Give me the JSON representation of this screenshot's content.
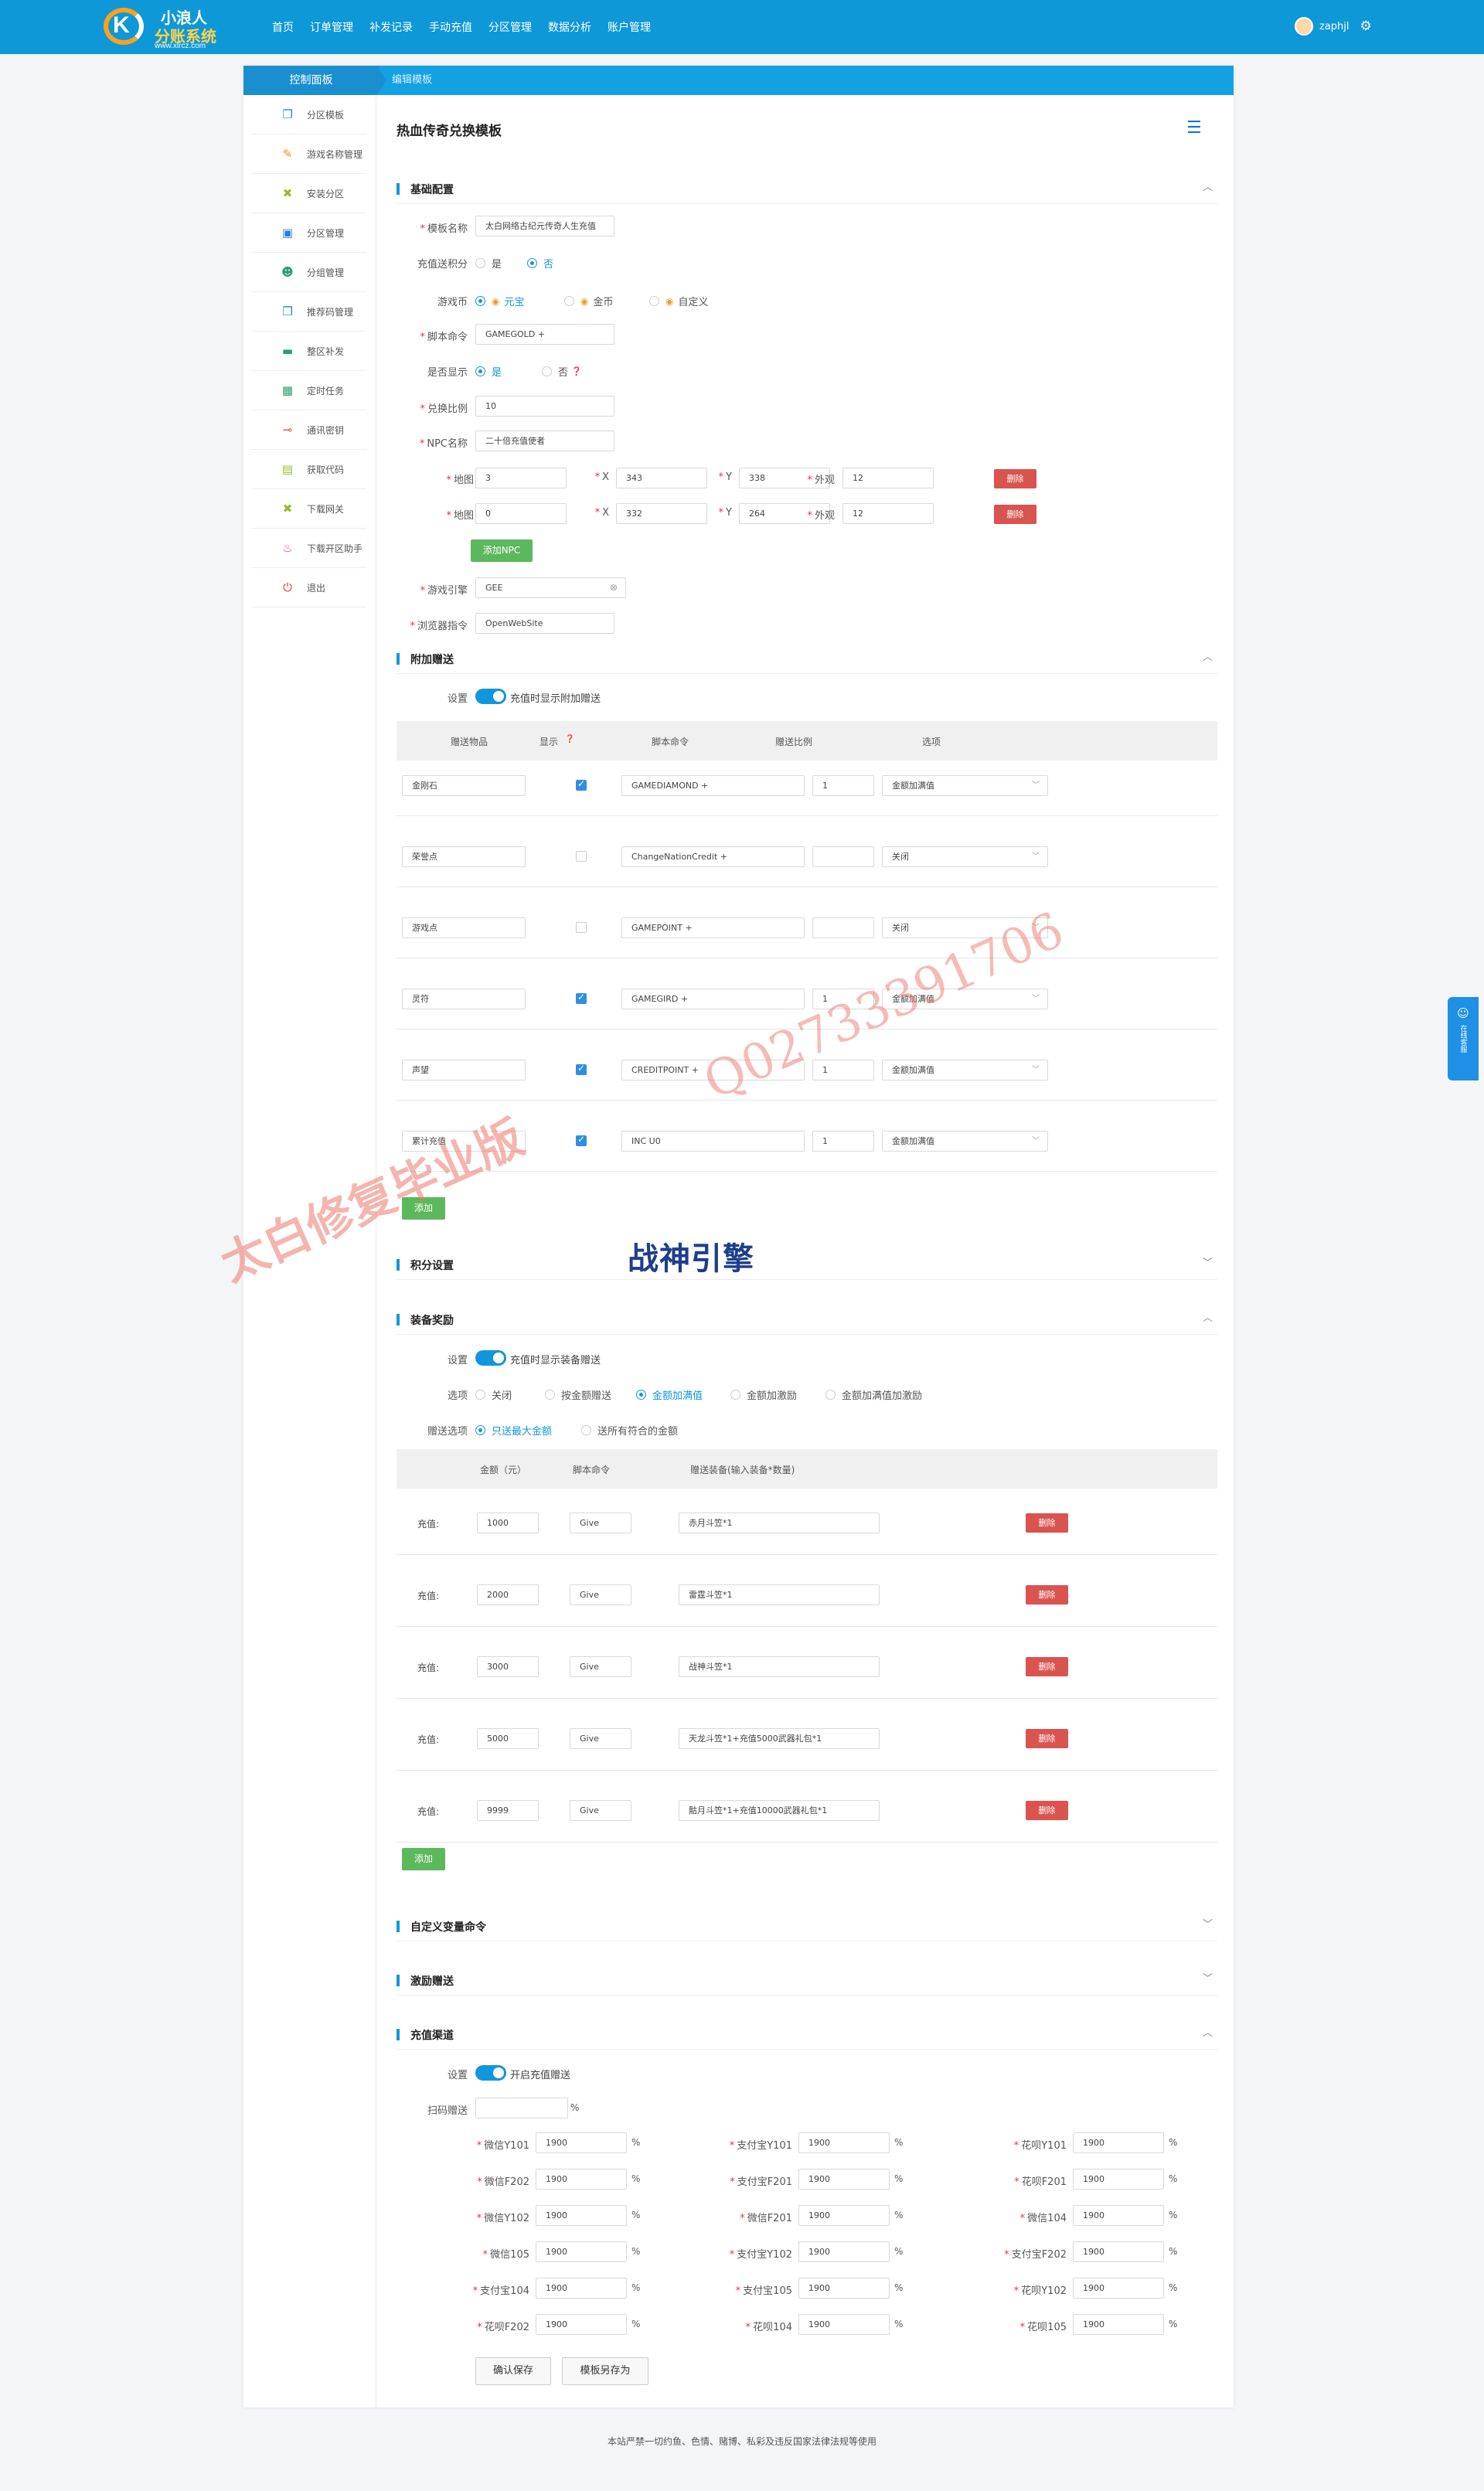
{
  "brand": {
    "line1": "小浪人",
    "line2": "分账系统",
    "url": "www.xlrcz.com"
  },
  "nav": [
    "首页",
    "订单管理",
    "补发记录",
    "手动充值",
    "分区管理",
    "数据分析",
    "账户管理"
  ],
  "user": {
    "name": "zaphjl"
  },
  "tabs": {
    "left": "控制面板",
    "right": "编辑模板"
  },
  "sidebar": [
    {
      "label": "分区模板",
      "icon": "copy-icon",
      "color": "#2a7ed6"
    },
    {
      "label": "游戏名称管理",
      "icon": "pen-icon",
      "color": "#f08b1a"
    },
    {
      "label": "安装分区",
      "icon": "wrench-icon",
      "color": "#8fbf29"
    },
    {
      "label": "分区管理",
      "icon": "monitor-icon",
      "color": "#2a7ed6"
    },
    {
      "label": "分组管理",
      "icon": "users-icon",
      "color": "#2a9d6c"
    },
    {
      "label": "推荐码管理",
      "icon": "copy-icon",
      "color": "#2a7ed6"
    },
    {
      "label": "整区补发",
      "icon": "folder-icon",
      "color": "#2a9d6c"
    },
    {
      "label": "定时任务",
      "icon": "grid-icon",
      "color": "#2a9d6c"
    },
    {
      "label": "通讯密钥",
      "icon": "key-icon",
      "color": "#e2542f"
    },
    {
      "label": "获取代码",
      "icon": "box-icon",
      "color": "#8fbf29"
    },
    {
      "label": "下载网关",
      "icon": "wrench-icon",
      "color": "#8fbf29"
    },
    {
      "label": "下载开区助手",
      "icon": "cake-icon",
      "color": "#d9368b"
    },
    {
      "label": "退出",
      "icon": "power-icon",
      "color": "#e33"
    }
  ],
  "page_title": "热血传奇兑换模板",
  "basic": {
    "title": "基础配置",
    "template_name": {
      "label": "模板名称",
      "value": "太白网络古纪元传奇人生充值"
    },
    "recharge_points": {
      "label": "充值送积分",
      "opt_yes": "是",
      "opt_no": "否",
      "selected": "否"
    },
    "currency": {
      "label": "游戏币",
      "opts": [
        "元宝",
        "金币",
        "自定义"
      ],
      "selected": "元宝"
    },
    "script_cmd": {
      "label": "脚本命令",
      "value": "GAMEGOLD +"
    },
    "show": {
      "label": "是否显示",
      "opt_yes": "是",
      "opt_no": "否",
      "selected": "是"
    },
    "ratio": {
      "label": "兑换比例",
      "value": "10"
    },
    "npc": {
      "label": "NPC名称",
      "value": "二十倍充值使者"
    },
    "maps": [
      {
        "map": "3",
        "x": "343",
        "y": "338",
        "look": "12"
      },
      {
        "map": "0",
        "x": "332",
        "y": "264",
        "look": "12"
      }
    ],
    "map_labels": {
      "map": "地图",
      "x": "X",
      "y": "Y",
      "look": "外观",
      "delete": "删除",
      "add_npc": "添加NPC"
    },
    "engine": {
      "label": "游戏引擎",
      "value": "GEE"
    },
    "browser": {
      "label": "浏览器指令",
      "value": "OpenWebSite"
    }
  },
  "bonus": {
    "title": "附加赠送",
    "setting_label": "设置",
    "setting_text": "充值时显示附加赠送",
    "headers": [
      "赠送物品",
      "显示",
      "脚本命令",
      "赠送比例",
      "选项"
    ],
    "rows": [
      {
        "item": "金刚石",
        "show": true,
        "cmd": "GAMEDIAMOND +",
        "ratio": "1",
        "option": "金额加满值"
      },
      {
        "item": "荣誉点",
        "show": false,
        "cmd": "ChangeNationCredit +",
        "ratio": "",
        "option": "关闭"
      },
      {
        "item": "游戏点",
        "show": false,
        "cmd": "GAMEPOINT +",
        "ratio": "",
        "option": "关闭"
      },
      {
        "item": "灵符",
        "show": true,
        "cmd": "GAMEGIRD +",
        "ratio": "1",
        "option": "金额加满值"
      },
      {
        "item": "声望",
        "show": true,
        "cmd": "CREDITPOINT +",
        "ratio": "1",
        "option": "金额加满值"
      },
      {
        "item": "累计充值",
        "show": true,
        "cmd": "INC U0",
        "ratio": "1",
        "option": "金额加满值"
      }
    ],
    "add": "添加"
  },
  "points_settings": {
    "title": "积分设置"
  },
  "equip": {
    "title": "装备奖励",
    "setting_label": "设置",
    "setting_text": "充值时显示装备赠送",
    "options_label": "选项",
    "options": [
      "关闭",
      "按金额赠送",
      "金额加满值",
      "金额加激励",
      "金额加满值加激励"
    ],
    "options_selected": "金额加满值",
    "gift_label": "赠送选项",
    "gift_opts": [
      "只送最大金额",
      "送所有符合的金额"
    ],
    "gift_selected": "只送最大金额",
    "headers": [
      "金额（元）",
      "脚本命令",
      "赠送装备(输入装备*数量)"
    ],
    "row_label": "充值:",
    "rows": [
      {
        "amount": "1000",
        "cmd": "Give",
        "item": "赤月斗笠*1"
      },
      {
        "amount": "2000",
        "cmd": "Give",
        "item": "雷霆斗笠*1"
      },
      {
        "amount": "3000",
        "cmd": "Give",
        "item": "战神斗笠*1"
      },
      {
        "amount": "5000",
        "cmd": "Give",
        "item": "天龙斗笠*1+充值5000武器礼包*1"
      },
      {
        "amount": "9999",
        "cmd": "Give",
        "item": "骷月斗笠*1+充值10000武器礼包*1"
      }
    ],
    "delete": "删除",
    "add": "添加"
  },
  "custom_vars": {
    "title": "自定义变量命令"
  },
  "incentive": {
    "title": "激励赠送"
  },
  "channel": {
    "title": "充值渠道",
    "setting_label": "设置",
    "setting_text": "开启充值赠送",
    "scan_label": "扫码赠送",
    "scan_value": "",
    "rows": [
      [
        {
          "name": "微信Y101",
          "value": "1900"
        },
        {
          "name": "支付宝Y101",
          "value": "1900"
        },
        {
          "name": "花呗Y101",
          "value": "1900"
        }
      ],
      [
        {
          "name": "微信F202",
          "value": "1900"
        },
        {
          "name": "支付宝F201",
          "value": "1900"
        },
        {
          "name": "花呗F201",
          "value": "1900"
        }
      ],
      [
        {
          "name": "微信Y102",
          "value": "1900"
        },
        {
          "name": "微信F201",
          "value": "1900"
        },
        {
          "name": "微信104",
          "value": "1900"
        }
      ],
      [
        {
          "name": "微信105",
          "value": "1900"
        },
        {
          "name": "支付宝Y102",
          "value": "1900"
        },
        {
          "name": "支付宝F202",
          "value": "1900"
        }
      ],
      [
        {
          "name": "支付宝104",
          "value": "1900"
        },
        {
          "name": "支付宝105",
          "value": "1900"
        },
        {
          "name": "花呗Y102",
          "value": "1900"
        }
      ],
      [
        {
          "name": "花呗F202",
          "value": "1900"
        },
        {
          "name": "花呗104",
          "value": "1900"
        },
        {
          "name": "花呗105",
          "value": "1900"
        }
      ]
    ],
    "unit": "%"
  },
  "actions": {
    "save": "确认保存",
    "save_as": "模板另存为"
  },
  "footer": "本站严禁一切约鱼、色情、赌博、私彩及违反国家法律法规等使用",
  "float_button": "在线客服",
  "watermarks": {
    "left": "太白修复毕业版",
    "right": "Q02733391706",
    "center": "战神引擎"
  }
}
